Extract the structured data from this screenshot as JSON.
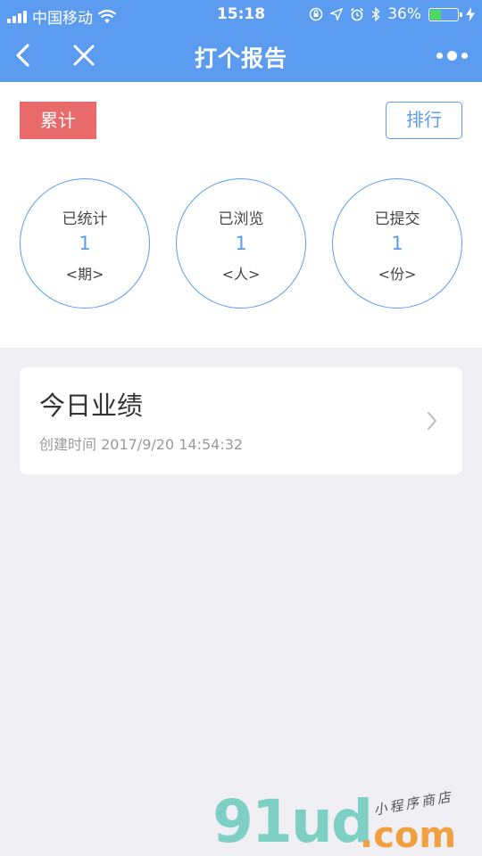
{
  "statusbar": {
    "carrier": "中国移动",
    "time": "15:18",
    "battery_percent": "36%",
    "battery_level": 0.36,
    "icons": [
      "signal-icon",
      "wifi-icon",
      "orientation-lock-icon",
      "location-icon",
      "alarm-icon",
      "bluetooth-icon",
      "battery-icon",
      "charging-icon"
    ]
  },
  "navbar": {
    "title": "打个报告",
    "icons": [
      "back-arrow-icon",
      "close-icon",
      "more-dots-icon"
    ]
  },
  "summary": {
    "tag_label": "累计",
    "rank_button": "排行",
    "stats": [
      {
        "label": "已统计",
        "value": "1",
        "unit": "<期>"
      },
      {
        "label": "已浏览",
        "value": "1",
        "unit": "<人>"
      },
      {
        "label": "已提交",
        "value": "1",
        "unit": "<份>"
      }
    ]
  },
  "report_card": {
    "title": "今日业绩",
    "created_label": "创建时间 2017/9/20 14:54:32"
  },
  "watermark": {
    "brand": "91ud",
    "domain": ".com",
    "tagline": "小程序商店"
  },
  "colors": {
    "primary": "#5b9cf0",
    "tag_red": "#e96a6a",
    "background": "#efeff4"
  }
}
